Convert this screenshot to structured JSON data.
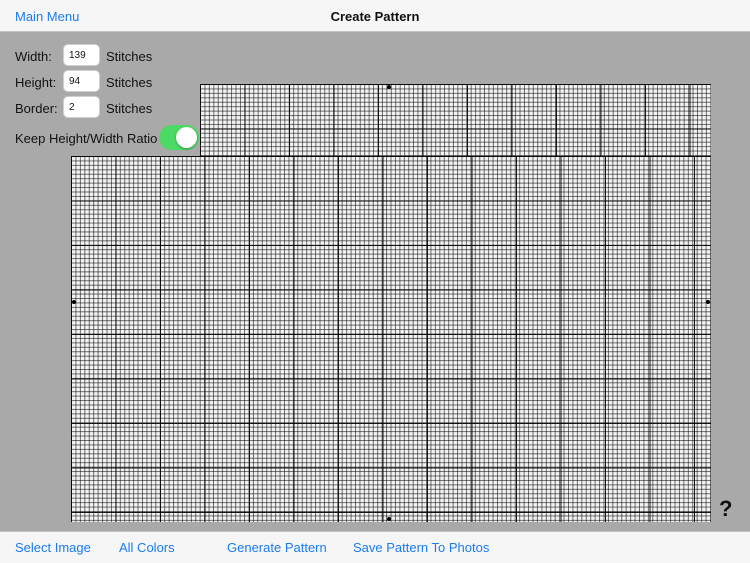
{
  "navbar": {
    "back_label": "Main Menu",
    "title": "Create Pattern"
  },
  "form": {
    "width": {
      "label": "Width:",
      "value": "139",
      "unit": "Stitches"
    },
    "height": {
      "label": "Height:",
      "value": "94",
      "unit": "Stitches"
    },
    "border": {
      "label": "Border:",
      "value": "2",
      "unit": "Stitches"
    },
    "keep_ratio": {
      "label": "Keep Height/Width Ratio",
      "on": true
    }
  },
  "help_label": "?",
  "toolbar": {
    "select_image": "Select Image",
    "all_colors": "All Colors",
    "generate_pattern": "Generate Pattern",
    "save_pattern": "Save Pattern To Photos"
  },
  "colors": {
    "accent": "#1a7cf0",
    "toggle_on": "#4cd964",
    "canvas_bg": "#a9a9a9"
  }
}
